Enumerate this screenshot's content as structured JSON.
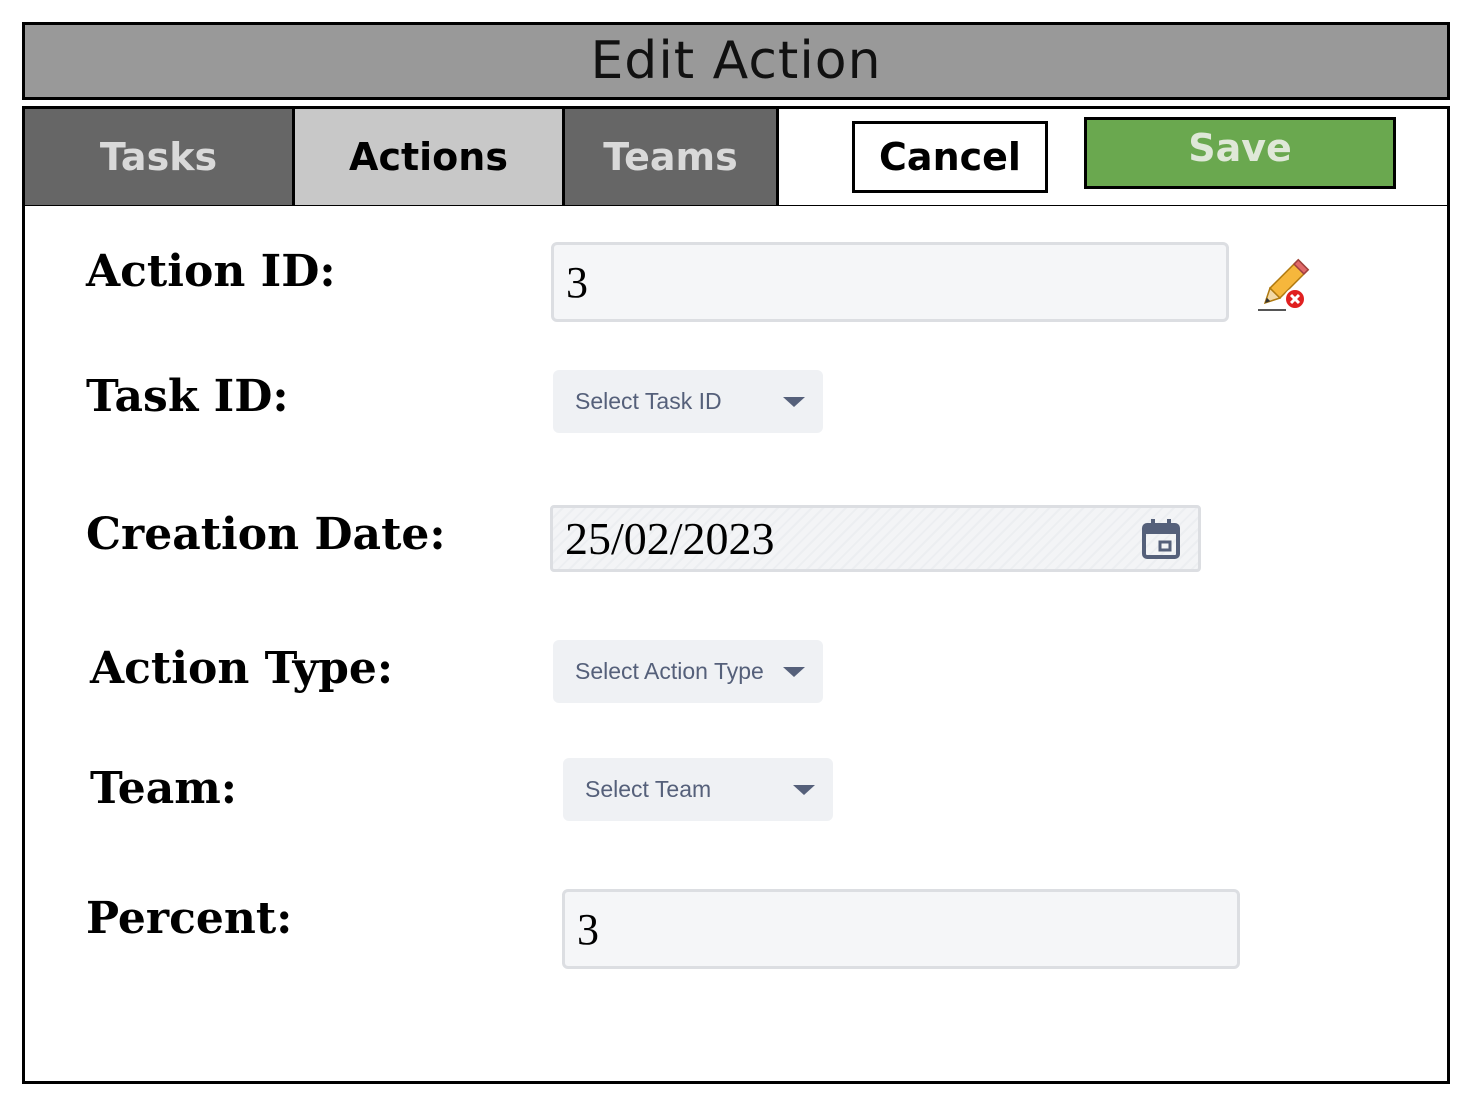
{
  "window": {
    "title": "Edit Action"
  },
  "tabs": [
    {
      "label": "Tasks",
      "active": false
    },
    {
      "label": "Actions",
      "active": true
    },
    {
      "label": "Teams",
      "active": false
    }
  ],
  "buttons": {
    "cancel": "Cancel",
    "save": "Save"
  },
  "form": {
    "action_id": {
      "label": "Action ID:",
      "value": "3",
      "icon": "pencil-delete-icon"
    },
    "task_id": {
      "label": "Task ID:",
      "placeholder": "Select Task ID"
    },
    "creation_date": {
      "label": "Creation Date:",
      "value": "25/02/2023",
      "icon": "calendar-icon"
    },
    "action_type": {
      "label": "Action Type:",
      "placeholder": "Select Action Type"
    },
    "team": {
      "label": "Team:",
      "placeholder": "Select Team"
    },
    "percent": {
      "label": "Percent:",
      "value": "3"
    }
  },
  "colors": {
    "title_bar": "#999999",
    "tab_inactive": "#666666",
    "tab_active": "#c8c8c8",
    "save_button": "#6aa84f",
    "select_text": "#55607a"
  }
}
